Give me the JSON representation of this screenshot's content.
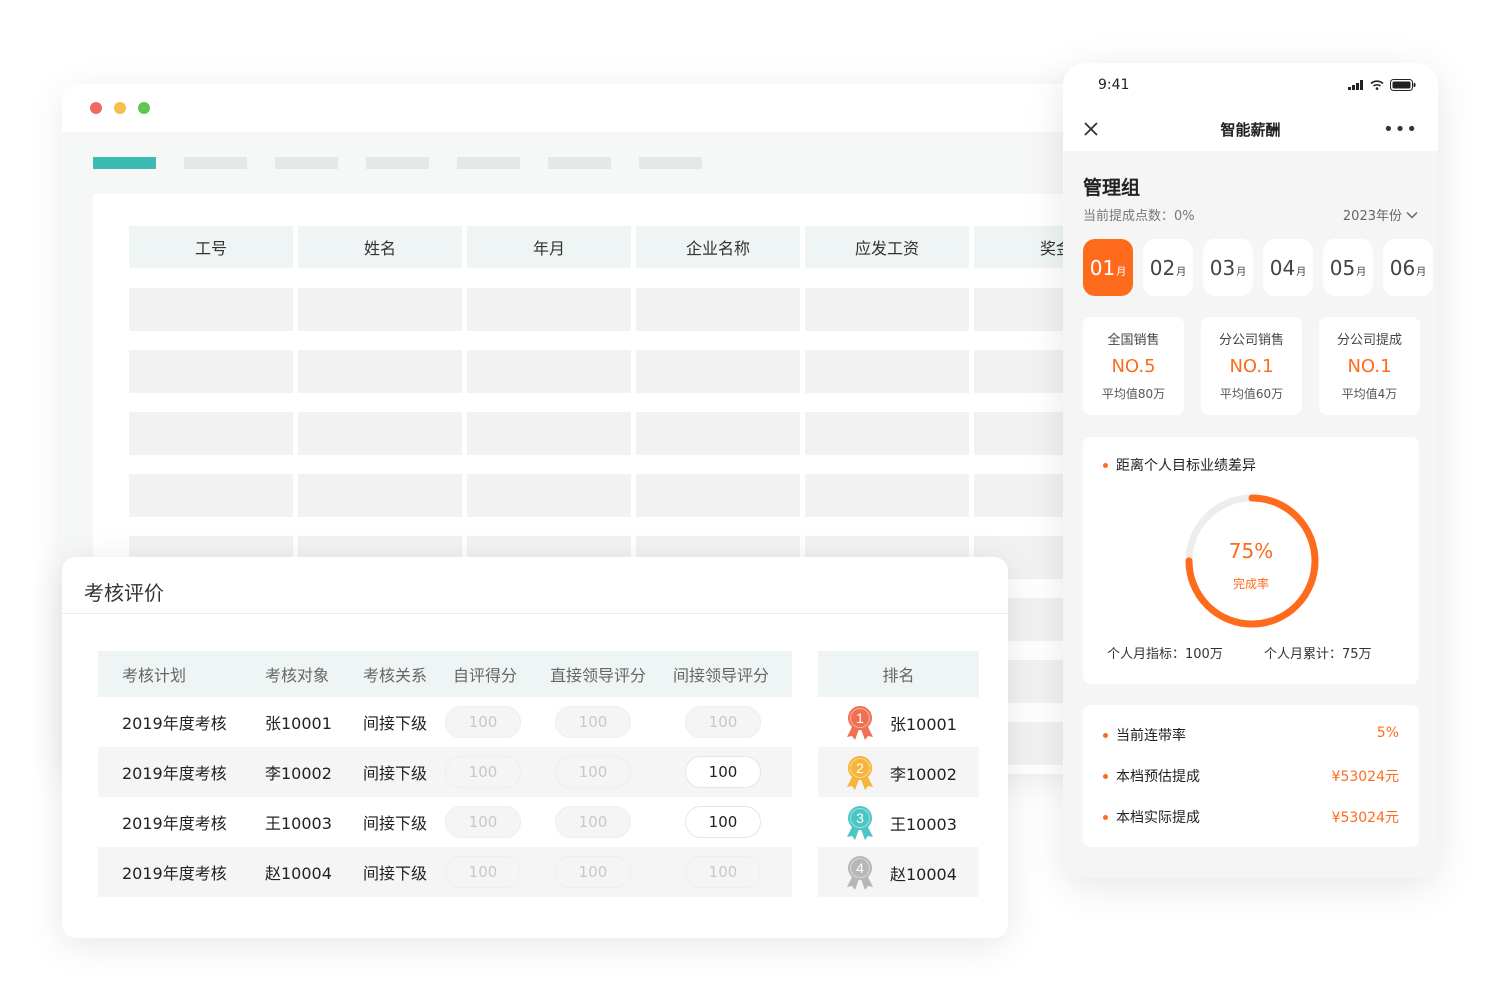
{
  "colors": {
    "accent": "#ff6b1d",
    "teal": "#3bbbb3",
    "header_bg": "#eef5f4"
  },
  "desktop": {
    "window_dots": [
      "#ed6a5e",
      "#f5bf4f",
      "#61c554"
    ],
    "salary_table": {
      "headers": [
        "工号",
        "姓名",
        "年月",
        "企业名称",
        "应发工资",
        "奖金"
      ]
    }
  },
  "evaluation": {
    "title": "考核评价",
    "headers": [
      "考核计划",
      "考核对象",
      "考核关系",
      "自评得分",
      "直接领导评分",
      "间接领导评分"
    ],
    "rows": [
      {
        "plan": "2019年度考核",
        "target": "张10001",
        "relation": "间接下级",
        "self": "100",
        "direct": "100",
        "indirect": "100",
        "indirect_active": false
      },
      {
        "plan": "2019年度考核",
        "target": "李10002",
        "relation": "间接下级",
        "self": "100",
        "direct": "100",
        "indirect": "100",
        "indirect_active": true
      },
      {
        "plan": "2019年度考核",
        "target": "王10003",
        "relation": "间接下级",
        "self": "100",
        "direct": "100",
        "indirect": "100",
        "indirect_active": true
      },
      {
        "plan": "2019年度考核",
        "target": "赵10004",
        "relation": "间接下级",
        "self": "100",
        "direct": "100",
        "indirect": "100",
        "indirect_active": false
      }
    ],
    "ranking": {
      "header": "排名",
      "items": [
        {
          "rank": "1",
          "name": "张10001",
          "color": "#f07052"
        },
        {
          "rank": "2",
          "name": "李10002",
          "color": "#f6b43a"
        },
        {
          "rank": "3",
          "name": "王10003",
          "color": "#4cc6c4"
        },
        {
          "rank": "4",
          "name": "赵10004",
          "color": "#b7b7b7"
        }
      ]
    }
  },
  "phone": {
    "time": "9:41",
    "nav_title": "智能薪酬",
    "group": "管理组",
    "commission_points": "当前提成点数：0%",
    "year": "2023年份",
    "months": [
      {
        "num": "01",
        "unit": "月",
        "active": true
      },
      {
        "num": "02",
        "unit": "月",
        "active": false
      },
      {
        "num": "03",
        "unit": "月",
        "active": false
      },
      {
        "num": "04",
        "unit": "月",
        "active": false
      },
      {
        "num": "05",
        "unit": "月",
        "active": false
      },
      {
        "num": "06",
        "unit": "月",
        "active": false
      }
    ],
    "stats": [
      {
        "label": "全国销售",
        "value": "NO.5",
        "avg": "平均值80万"
      },
      {
        "label": "分公司销售",
        "value": "NO.1",
        "avg": "平均值60万"
      },
      {
        "label": "分公司提成",
        "value": "NO.1",
        "avg": "平均值4万"
      }
    ],
    "goal": {
      "title": "距离个人目标业绩差异",
      "percent_value": 75,
      "percent": "75%",
      "percent_label": "完成率",
      "target": "个人月指标：100万",
      "accumulated": "个人月累计：75万"
    },
    "metrics": [
      {
        "label": "当前连带率",
        "value": "5%"
      },
      {
        "label": "本档预估提成",
        "value": "¥53024元"
      },
      {
        "label": "本档实际提成",
        "value": "¥53024元"
      }
    ]
  }
}
